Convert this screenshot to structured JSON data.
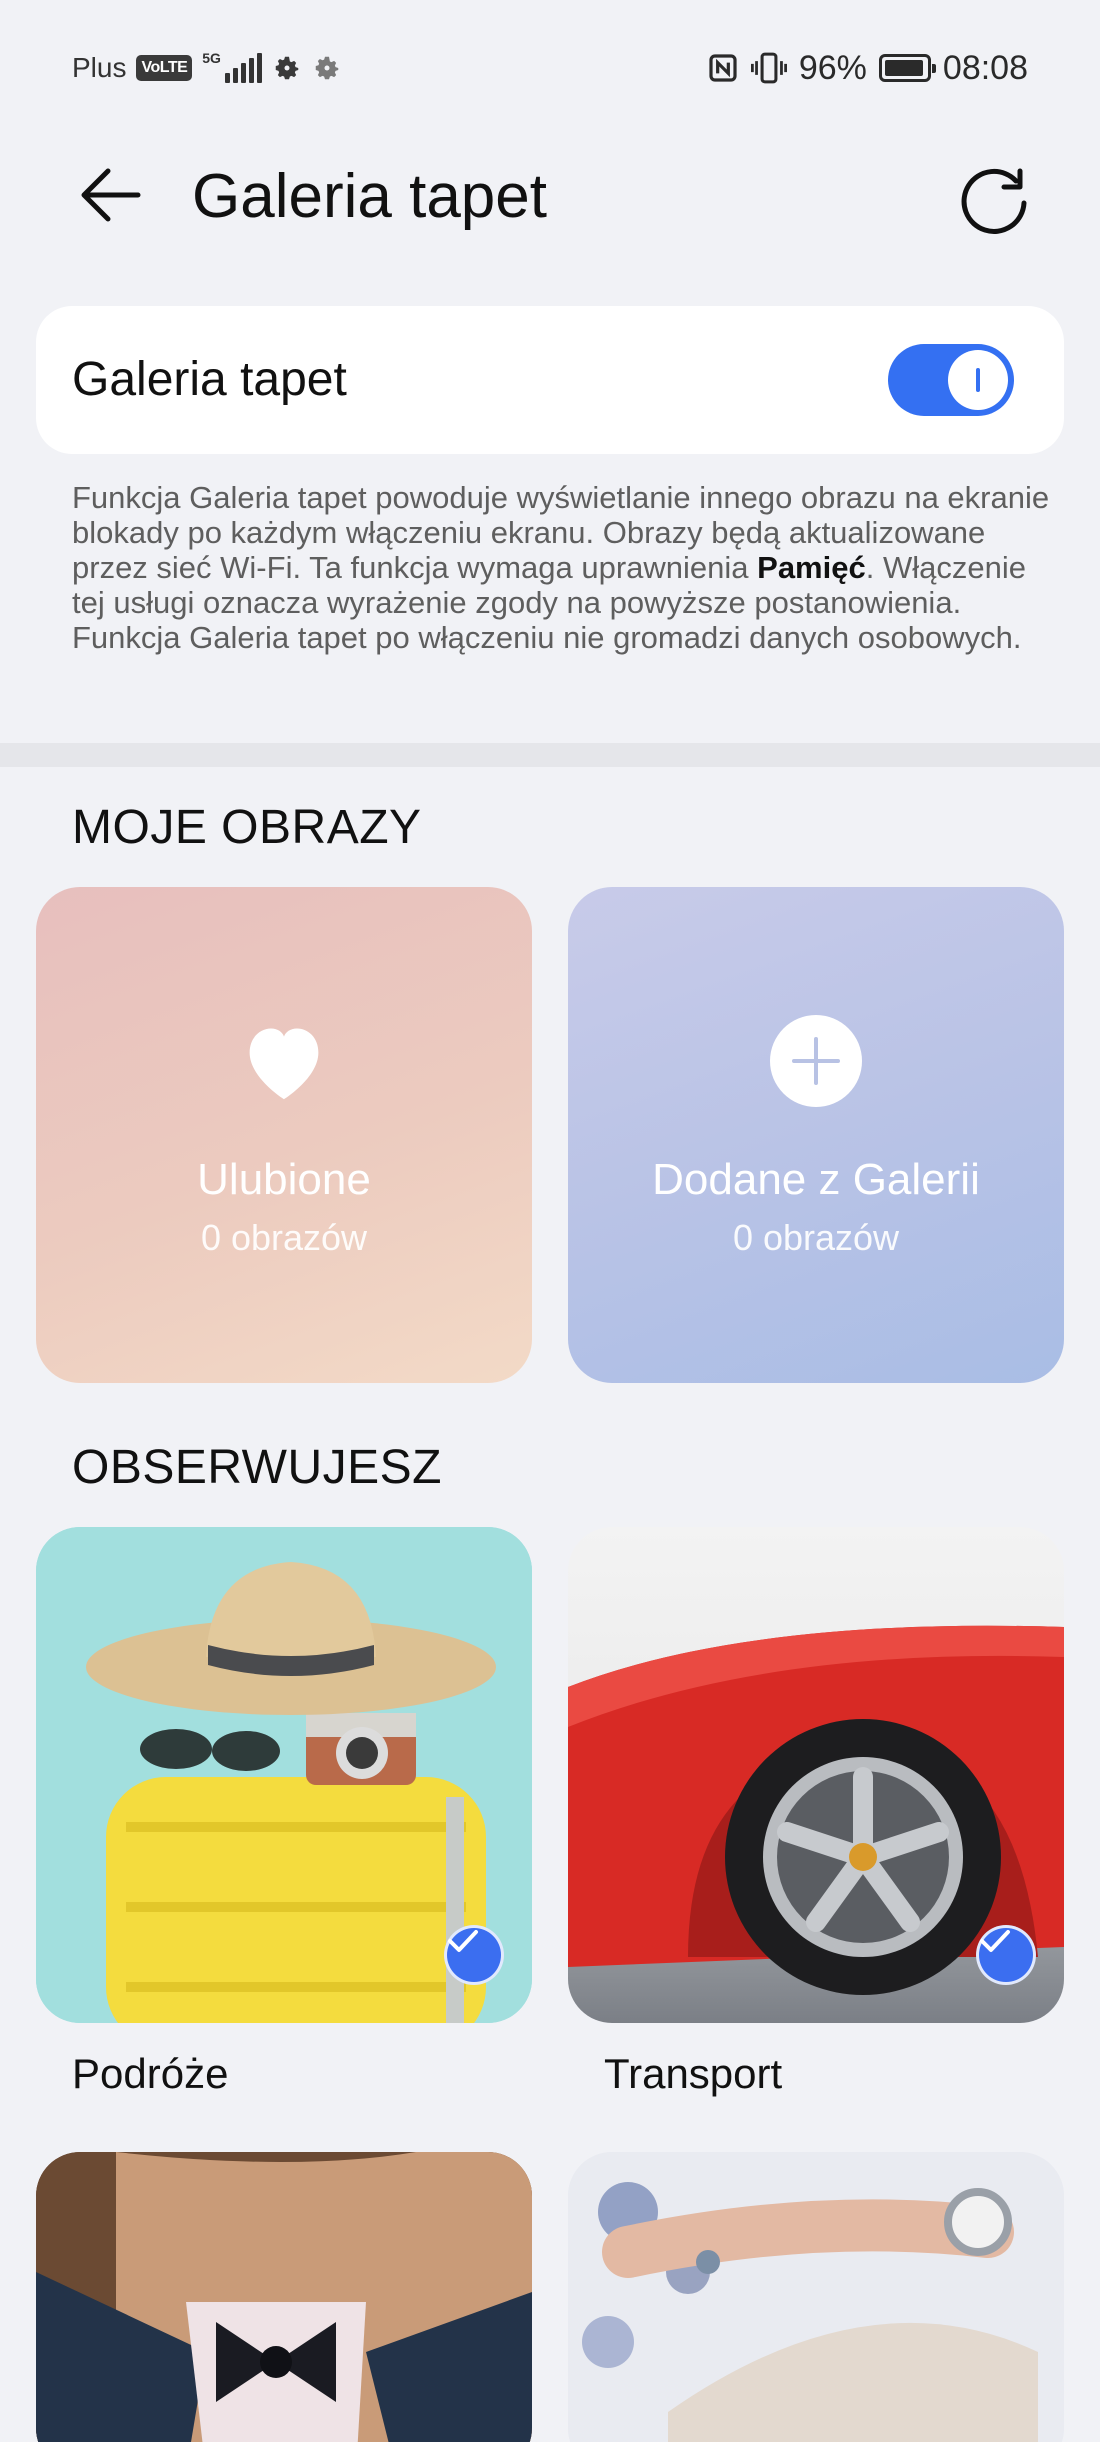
{
  "status_bar": {
    "carrier": "Plus",
    "volte": "VoLTE",
    "network": "5G",
    "battery": "96%",
    "time": "08:08"
  },
  "app_bar": {
    "title": "Galeria tapet"
  },
  "toggle": {
    "label": "Galeria tapet",
    "enabled": true
  },
  "description": {
    "part1": "Funkcja Galeria tapet powoduje wyświetlanie innego obrazu na ekranie blokady po każdym włączeniu ekranu. Obrazy będą aktualizowane przez sieć Wi-Fi. Ta funkcja wymaga uprawnienia ",
    "bold": "Pamięć",
    "part2": ". Włączenie tej usługi oznacza wyrażenie zgody na powyższe postanowienia. Funkcja Galeria tapet po włączeniu nie gromadzi danych osobowych."
  },
  "my_images": {
    "heading": "MOJE OBRAZY",
    "tiles": [
      {
        "title": "Ulubione",
        "count": "0 obrazów",
        "icon": "heart-icon"
      },
      {
        "title": "Dodane z Galerii",
        "count": "0 obrazów",
        "icon": "plus-icon"
      }
    ]
  },
  "following": {
    "heading": "OBSERWUJESZ",
    "categories": [
      {
        "label": "Podróże",
        "selected": true
      },
      {
        "label": "Transport",
        "selected": true
      },
      {
        "label": "",
        "selected": false
      },
      {
        "label": "",
        "selected": false
      }
    ]
  },
  "colors": {
    "accent": "#3470f2",
    "background": "#f1f2f6"
  }
}
